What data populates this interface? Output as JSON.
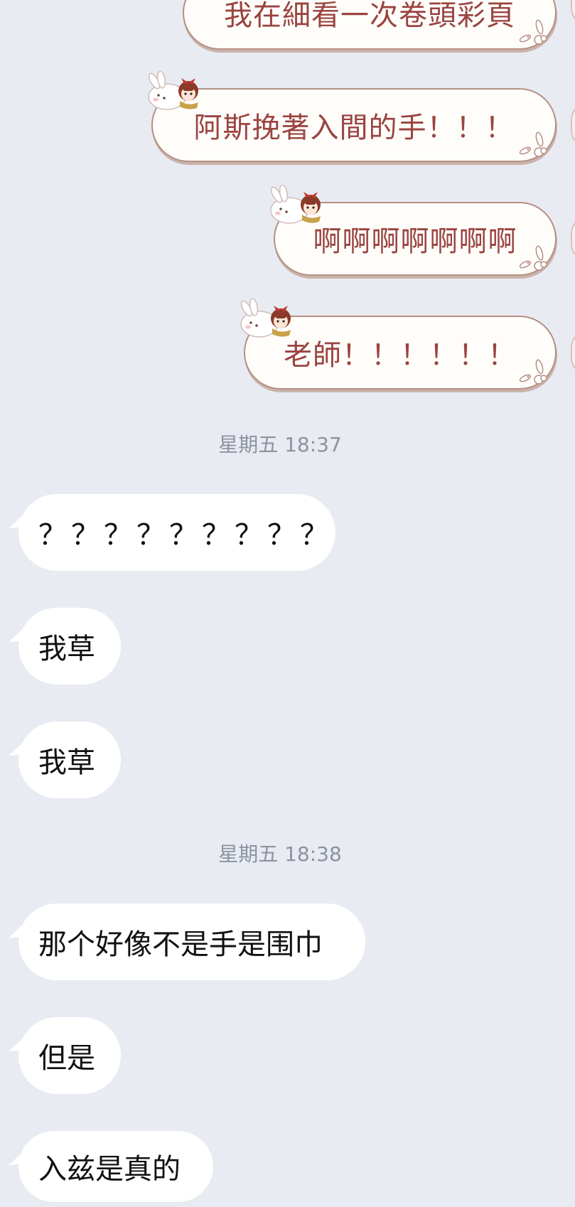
{
  "outgoing": [
    "我在細看一次卷頭彩頁",
    "阿斯挽著入間的手！！！",
    "啊啊啊啊啊啊啊",
    "老師！！！！！！"
  ],
  "timestamps": [
    "星期五 18:37",
    "星期五 18:38"
  ],
  "incoming": [
    "？？？？？？？？？",
    "我草",
    "我草",
    "那个好像不是手是围巾",
    "但是",
    "入兹是真的"
  ],
  "colors": {
    "background": "#e8ebf2",
    "outgoing_text": "#9a4440",
    "outgoing_border": "#b49084",
    "incoming_bubble": "#ffffff",
    "timestamp_text": "#8c939e"
  }
}
